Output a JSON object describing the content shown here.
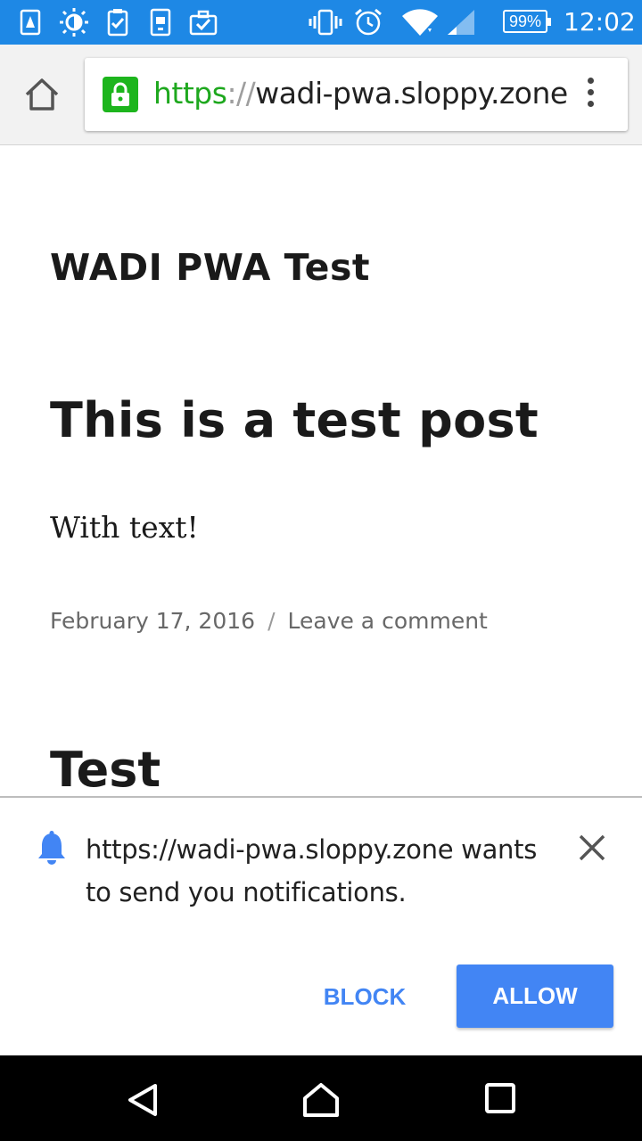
{
  "status_bar": {
    "battery_percent": "99%",
    "time": "12:02",
    "icons": [
      "sim-alert-icon",
      "brightness-icon",
      "clipboard-check-icon",
      "device-icon",
      "briefcase-check-icon",
      "vibrate-icon",
      "alarm-icon",
      "wifi-icon",
      "signal-icon",
      "battery-icon"
    ]
  },
  "toolbar": {
    "url_scheme": "https",
    "url_separator": "://",
    "url_host": "wadi-pwa.sloppy.zone",
    "secure_color": "#1db51d"
  },
  "page": {
    "site_title": "WADI PWA Test",
    "posts": [
      {
        "title": "This is a test post",
        "body": "With text!",
        "date": "February 17, 2016",
        "separator": "/",
        "comment_link": "Leave a comment"
      },
      {
        "title": "Test"
      }
    ]
  },
  "notification_prompt": {
    "message": "https://wadi-pwa.sloppy.zone wants to send you notifications.",
    "block_label": "BLOCK",
    "allow_label": "ALLOW",
    "accent_color": "#4285f4"
  }
}
